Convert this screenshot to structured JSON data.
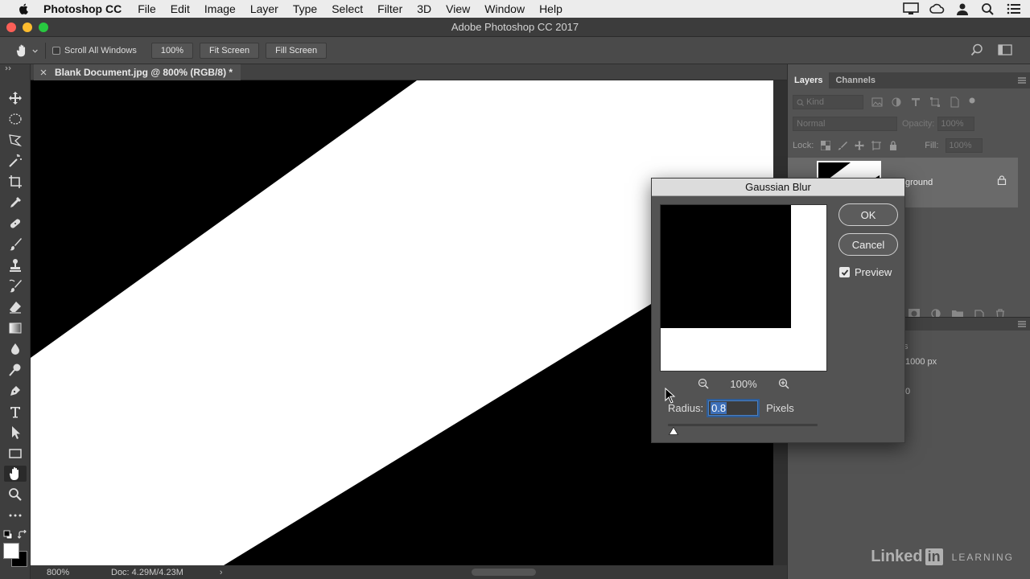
{
  "menubar": {
    "app_name": "Photoshop CC",
    "items": [
      "File",
      "Edit",
      "Image",
      "Layer",
      "Type",
      "Select",
      "Filter",
      "3D",
      "View",
      "Window",
      "Help"
    ]
  },
  "window": {
    "title": "Adobe Photoshop CC 2017"
  },
  "options": {
    "scroll_all_windows": "Scroll All Windows",
    "zoom_100": "100%",
    "fit_screen": "Fit Screen",
    "fill_screen": "Fill Screen"
  },
  "document": {
    "tab_title": "Blank Document.jpg @ 800% (RGB/8) *",
    "status_zoom": "800%",
    "status_doc": "Doc: 4.29M/4.23M",
    "status_arrow": "›"
  },
  "layers_panel": {
    "tab_layers": "Layers",
    "tab_channels": "Channels",
    "kind_label": "Kind",
    "blend_mode": "Normal",
    "opacity_label": "Opacity:",
    "opacity_value": "100%",
    "lock_label": "Lock:",
    "fill_label": "Fill:",
    "fill_value": "100%",
    "layer_name_visible": "ground"
  },
  "properties_panel": {
    "text1": "s",
    "text2": "1000 px",
    "text3": "0"
  },
  "dialog": {
    "title": "Gaussian Blur",
    "ok": "OK",
    "cancel": "Cancel",
    "preview_label": "Preview",
    "zoom_value": "100%",
    "radius_label": "Radius:",
    "radius_value": "0.8",
    "radius_unit": "Pixels",
    "slider_value": 0.8
  },
  "watermark": {
    "linked": "Linked",
    "in": "in",
    "learning": "LEARNING"
  },
  "colors": {
    "accent": "#3d6fb8",
    "panel_bg": "#535353",
    "toolbar_bg": "#3e3e3e"
  }
}
